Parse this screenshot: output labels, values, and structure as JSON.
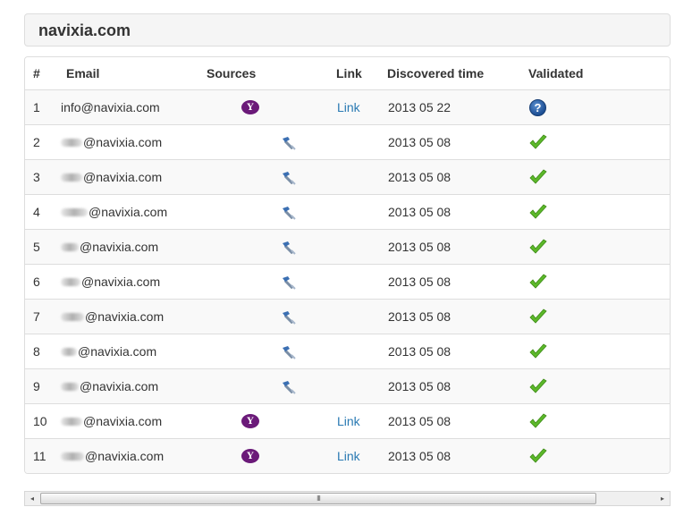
{
  "header": {
    "title": "navixia.com"
  },
  "table": {
    "columns": [
      "#",
      "Email",
      "Sources",
      "Link",
      "Discovered time",
      "Validated"
    ],
    "rows": [
      {
        "num": "1",
        "email_prefix": "info",
        "email_domain": "@navixia.com",
        "redacted": false,
        "source": "yahoo-icon",
        "link": "Link",
        "date": "2013 05 22",
        "validated": "question-icon"
      },
      {
        "num": "2",
        "email_prefix": "",
        "email_domain": "@navixia.com",
        "redacted": true,
        "source": "tool-icon",
        "link": "",
        "date": "2013 05 08",
        "validated": "checkmark-icon"
      },
      {
        "num": "3",
        "email_prefix": "",
        "email_domain": "@navixia.com",
        "redacted": true,
        "source": "tool-icon",
        "link": "",
        "date": "2013 05 08",
        "validated": "checkmark-icon"
      },
      {
        "num": "4",
        "email_prefix": "",
        "email_domain": "@navixia.com",
        "redacted": true,
        "source": "tool-icon",
        "link": "",
        "date": "2013 05 08",
        "validated": "checkmark-icon"
      },
      {
        "num": "5",
        "email_prefix": "",
        "email_domain": "@navixia.com",
        "redacted": true,
        "source": "tool-icon",
        "link": "",
        "date": "2013 05 08",
        "validated": "checkmark-icon"
      },
      {
        "num": "6",
        "email_prefix": "",
        "email_domain": "@navixia.com",
        "redacted": true,
        "source": "tool-icon",
        "link": "",
        "date": "2013 05 08",
        "validated": "checkmark-icon"
      },
      {
        "num": "7",
        "email_prefix": "",
        "email_domain": "@navixia.com",
        "redacted": true,
        "source": "tool-icon",
        "link": "",
        "date": "2013 05 08",
        "validated": "checkmark-icon"
      },
      {
        "num": "8",
        "email_prefix": "",
        "email_domain": "@navixia.com",
        "redacted": true,
        "source": "tool-icon",
        "link": "",
        "date": "2013 05 08",
        "validated": "checkmark-icon"
      },
      {
        "num": "9",
        "email_prefix": "",
        "email_domain": "@navixia.com",
        "redacted": true,
        "source": "tool-icon",
        "link": "",
        "date": "2013 05 08",
        "validated": "checkmark-icon"
      },
      {
        "num": "10",
        "email_prefix": "",
        "email_domain": "@navixia.com",
        "redacted": true,
        "source": "yahoo-icon",
        "link": "Link",
        "date": "2013 05 08",
        "validated": "checkmark-icon"
      },
      {
        "num": "11",
        "email_prefix": "",
        "email_domain": "@navixia.com",
        "redacted": true,
        "source": "yahoo-icon",
        "link": "Link",
        "date": "2013 05 08",
        "validated": "checkmark-icon"
      }
    ]
  },
  "icons": {
    "yahoo_glyph": "Y",
    "question_glyph": "?",
    "scroll_left": "◂",
    "scroll_right": "▸",
    "scroll_grip": "III"
  },
  "colors": {
    "link": "#2a7ab3",
    "yahoo": "#6b1a79",
    "check": "#5cb82a"
  }
}
